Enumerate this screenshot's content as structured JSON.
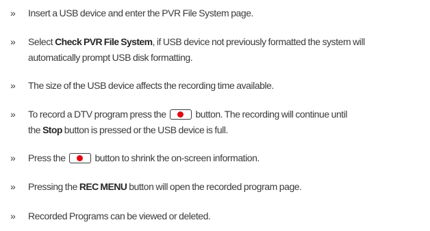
{
  "bullet_symbol": "»",
  "items": [
    {
      "line1": "Insert a USB device and enter the PVR File System page."
    },
    {
      "pre": "Select ",
      "bold": "Check PVR File System",
      "post": ", if USB device not previously formatted the system will",
      "line2": "automatically prompt USB disk formatting."
    },
    {
      "line1": "The size of the USB device affects the recording time available."
    },
    {
      "pre": "To record a DTV program press the ",
      "button_icon": "record-button-icon",
      "post": " button. The recording will continue until",
      "line2_pre": "the ",
      "line2_bold": "Stop",
      "line2_post": " button is pressed or the USB device is full."
    },
    {
      "pre": "Press the ",
      "button_icon": "record-button-icon",
      "post": " button to shrink the on-screen information."
    },
    {
      "pre": "Pressing the ",
      "bold": "REC MENU",
      "post": " button will open the recorded program page."
    },
    {
      "line1": "Recorded Programs can be viewed or deleted."
    }
  ],
  "colors": {
    "text": "#3a3a3a",
    "record_dot": "#e30613"
  }
}
